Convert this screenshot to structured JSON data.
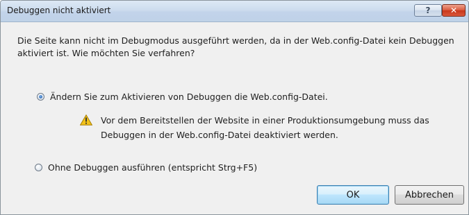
{
  "window": {
    "title": "Debuggen nicht aktiviert",
    "help_label": "?",
    "close_label": "✕"
  },
  "message": "Die Seite kann nicht im Debugmodus ausgeführt werden, da in der Web.config-Datei kein Debuggen aktiviert ist. Wie möchten Sie verfahren?",
  "options": [
    {
      "label": "Ändern Sie zum Aktivieren von Debuggen die Web.config-Datei.",
      "selected": true
    },
    {
      "label": "Ohne Debuggen ausführen (entspricht Strg+F5)",
      "selected": false
    }
  ],
  "warning": {
    "icon": "warning-triangle-icon",
    "line1": "Vor dem Bereitstellen der Website in einer Produktionsumgebung muss das",
    "line2": "Debuggen in der Web.config-Datei deaktiviert werden."
  },
  "buttons": {
    "ok_label": "OK",
    "cancel_label": "Abbrechen"
  },
  "colors": {
    "titlebar": "#c7d8ec",
    "dialog_bg": "#f0f0f0",
    "close_button": "#d9573a",
    "warning_icon": "#f2c21b"
  }
}
